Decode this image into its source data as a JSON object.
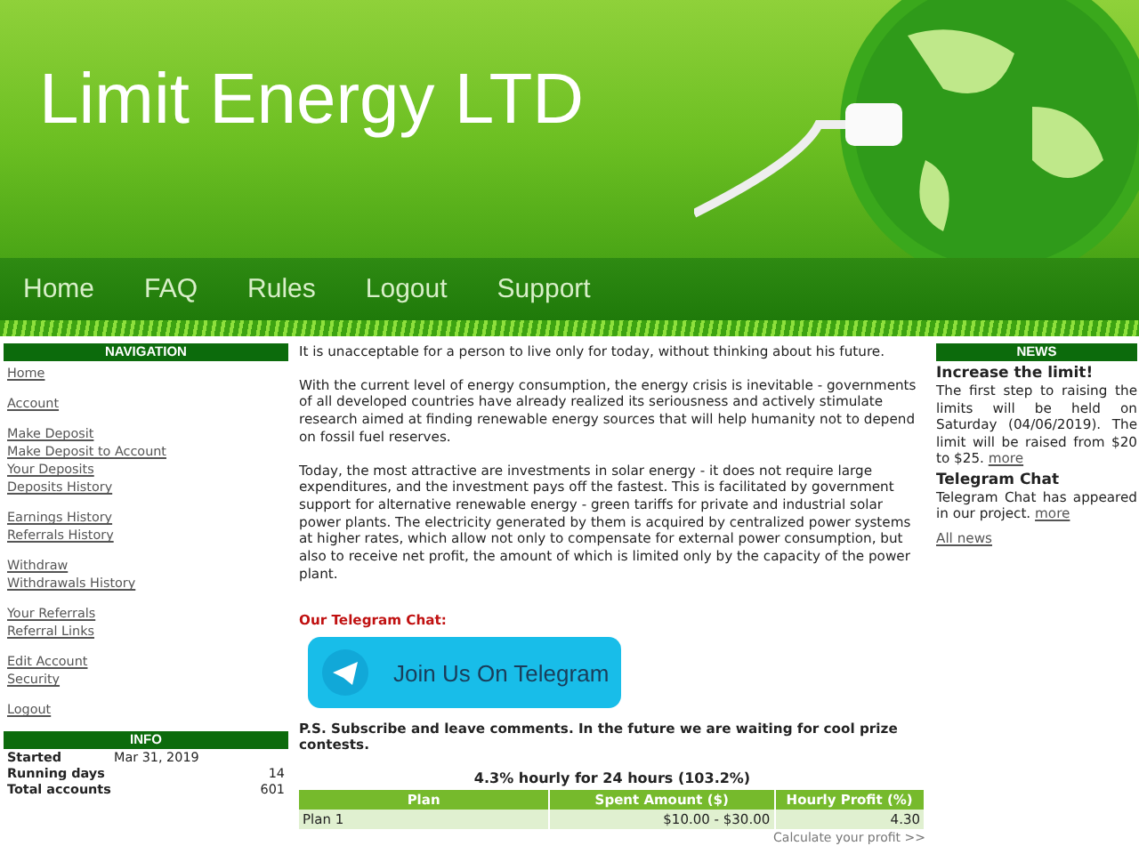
{
  "header": {
    "title": "Limit Energy LTD"
  },
  "top_menu": [
    {
      "label": "Home"
    },
    {
      "label": "FAQ"
    },
    {
      "label": "Rules"
    },
    {
      "label": "Logout"
    },
    {
      "label": "Support"
    }
  ],
  "navigation": {
    "title": "NAVIGATION",
    "groups": [
      [
        "Home"
      ],
      [
        "Account"
      ],
      [
        "Make Deposit",
        "Make Deposit to Account",
        "Your Deposits",
        "Deposits History"
      ],
      [
        "Earnings History",
        "Referrals History"
      ],
      [
        "Withdraw",
        "Withdrawals History"
      ],
      [
        "Your Referrals",
        "Referral Links"
      ],
      [
        "Edit Account",
        "Security"
      ],
      [
        "Logout"
      ]
    ]
  },
  "info": {
    "title": "INFO",
    "rows": [
      {
        "label": "Started",
        "value": "Mar 31, 2019"
      },
      {
        "label": "Running days",
        "value": "14"
      },
      {
        "label": "Total accounts",
        "value": "601"
      }
    ]
  },
  "content": {
    "paragraphs": [
      "It is unacceptable for a person to live only for today, without thinking about his future.",
      "With the current level of energy consumption, the energy crisis is inevitable - governments of all developed countries have already realized its seriousness and actively stimulate research aimed at finding renewable energy sources that will help humanity not to depend on fossil fuel reserves.",
      "Today, the most attractive are investments in solar energy - it does not require large expenditures, and the investment pays off the fastest. This is facilitated by government support for alternative renewable energy - green tariffs for private and industrial solar power plants. The electricity generated by them is acquired by centralized power systems at higher rates, which allow not only to compensate for external power consumption, but also to receive net profit, the amount of which is limited only by the capacity of the power plant."
    ],
    "telegram_heading": "Our Telegram Chat:",
    "telegram_button": "Join Us On Telegram",
    "ps": "P.S. Subscribe and leave comments. In the future we are waiting for cool prize contests.",
    "plan": {
      "title": "4.3% hourly for 24 hours (103.2%)",
      "columns": [
        "Plan",
        "Spent Amount ($)",
        "Hourly Profit (%)"
      ],
      "rows": [
        [
          "Plan 1",
          "$10.00 - $30.00",
          "4.30"
        ]
      ],
      "calc_link": "Calculate your profit >>"
    }
  },
  "news": {
    "title": "NEWS",
    "items": [
      {
        "title": "Increase the limit!",
        "text": "The first step to raising the limits will be held on Saturday (04/06/2019). The limit will be raised from $20 to $25.",
        "more": "more"
      },
      {
        "title": "Telegram Chat",
        "text": "Telegram Chat has appeared in our project.",
        "more": "more"
      }
    ],
    "all": "All news"
  }
}
